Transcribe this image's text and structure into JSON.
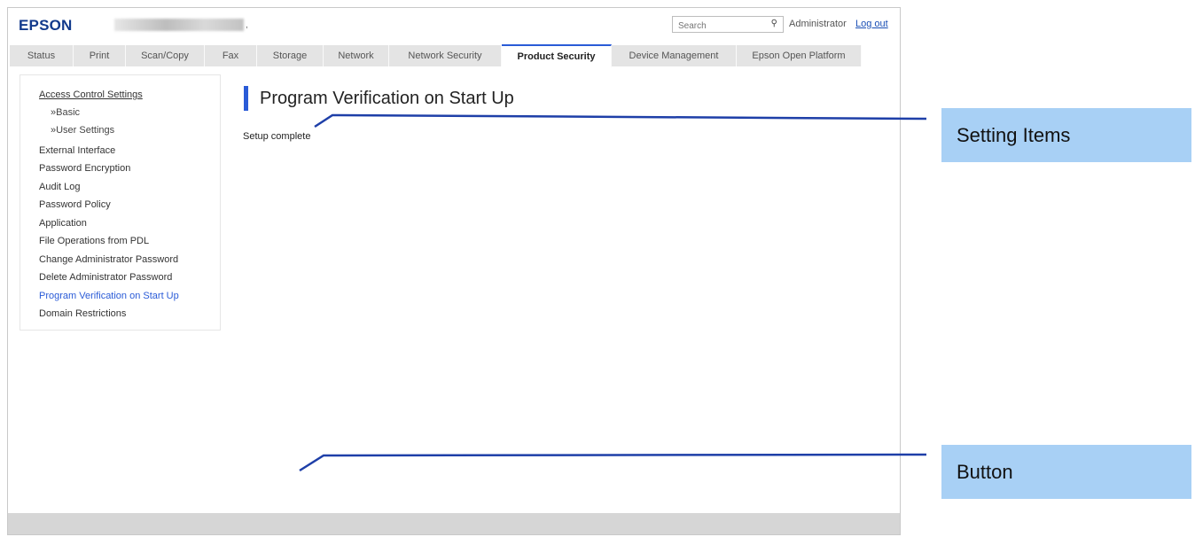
{
  "header": {
    "logo": "EPSON",
    "model_suffix": ",",
    "search_placeholder": "Search",
    "search_icon": "magnifier-icon",
    "user_label": "Administrator",
    "logout_label": "Log out"
  },
  "tabs": [
    {
      "label": "Status"
    },
    {
      "label": "Print"
    },
    {
      "label": "Scan/Copy"
    },
    {
      "label": "Fax"
    },
    {
      "label": "Storage"
    },
    {
      "label": "Network"
    },
    {
      "label": "Network Security"
    },
    {
      "label": "Product Security",
      "active": true
    },
    {
      "label": "Device Management"
    },
    {
      "label": "Epson Open Platform"
    }
  ],
  "sidebar": {
    "items": [
      {
        "label": "Access Control Settings"
      },
      {
        "label": "»Basic"
      },
      {
        "label": "»User Settings"
      },
      {
        "label": "External Interface"
      },
      {
        "label": "Password Encryption"
      },
      {
        "label": "Audit Log"
      },
      {
        "label": "Password Policy"
      },
      {
        "label": "Application"
      },
      {
        "label": "File Operations from PDL"
      },
      {
        "label": "Change Administrator Password"
      },
      {
        "label": "Delete Administrator Password"
      },
      {
        "label": "Program Verification on Start Up"
      },
      {
        "label": "Domain Restrictions"
      }
    ]
  },
  "main": {
    "title": "Program Verification on Start Up",
    "status": "Setup complete"
  },
  "callouts": {
    "setting_items": "Setting Items",
    "button": "Button"
  },
  "colors": {
    "accent": "#2a5bd7",
    "logo": "#123a8c",
    "callout_bg": "#a8d0f5",
    "callout_line": "#1e3fa8"
  }
}
